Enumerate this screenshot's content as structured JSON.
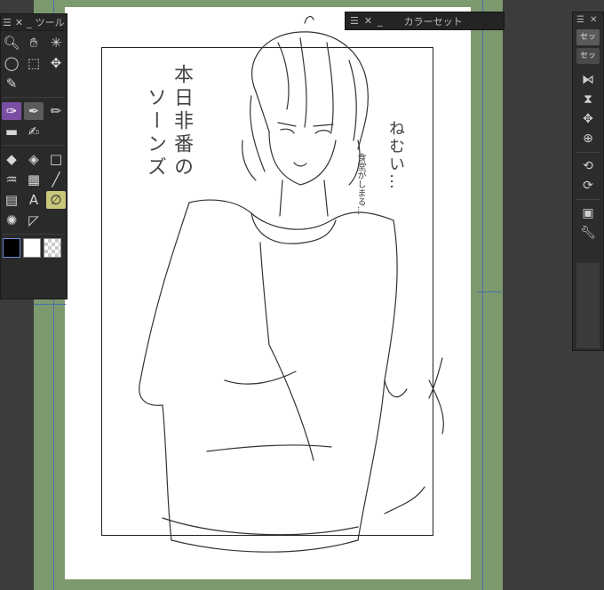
{
  "tool_panel": {
    "title": "ツール",
    "tools": [
      {
        "icon": "zoom-icon",
        "glyph": "🔍︎"
      },
      {
        "icon": "hand-icon",
        "glyph": "✋︎"
      },
      {
        "icon": "rotate-icon",
        "glyph": "✳"
      },
      {
        "icon": "lasso-select-icon",
        "glyph": "◯"
      },
      {
        "icon": "object-icon",
        "glyph": "⬚"
      },
      {
        "icon": "move-layer-icon",
        "glyph": "✥"
      },
      {
        "icon": "eyedropper-icon",
        "glyph": "✎"
      },
      {
        "icon": "blank-1",
        "glyph": ""
      },
      {
        "icon": "blank-2",
        "glyph": ""
      },
      {
        "icon": "pen-selected-icon",
        "glyph": "✑"
      },
      {
        "icon": "pen-nib-icon",
        "glyph": "✒"
      },
      {
        "icon": "pencil-icon",
        "glyph": "✏"
      },
      {
        "icon": "stamp-icon",
        "glyph": "▬"
      },
      {
        "icon": "airbrush-icon",
        "glyph": "✍"
      },
      {
        "icon": "blank-3",
        "glyph": ""
      },
      {
        "icon": "eraser-icon",
        "glyph": "◆"
      },
      {
        "icon": "fill-icon",
        "glyph": "◈"
      },
      {
        "icon": "figure-icon",
        "glyph": "□"
      },
      {
        "icon": "blend-icon",
        "glyph": "♒"
      },
      {
        "icon": "gradient-icon",
        "glyph": "▦"
      },
      {
        "icon": "brush-icon",
        "glyph": "╱"
      },
      {
        "icon": "frame-border-icon",
        "glyph": "▤"
      },
      {
        "icon": "text-icon",
        "glyph": "A"
      },
      {
        "icon": "correct-line-icon",
        "glyph": "∅"
      },
      {
        "icon": "ruler-icon",
        "glyph": "✺"
      },
      {
        "icon": "balloon-icon",
        "glyph": "◸"
      },
      {
        "icon": "blank-4",
        "glyph": ""
      }
    ]
  },
  "color_panel": {
    "title": "カラーセット"
  },
  "right_panel": {
    "tab1": "セッ",
    "tab2": "セッ",
    "icons": [
      {
        "icon": "flip-horizontal-icon",
        "glyph": "⧑"
      },
      {
        "icon": "flip-vertical-icon",
        "glyph": "⧗"
      },
      {
        "icon": "move-transform-icon",
        "glyph": "✥"
      },
      {
        "icon": "zoom-view-icon",
        "glyph": "⊕"
      },
      {
        "icon": "rotate-view-icon",
        "glyph": "⟲"
      },
      {
        "icon": "reset-view-icon",
        "glyph": "⟳"
      },
      {
        "icon": "screen-icon",
        "glyph": "▣"
      },
      {
        "icon": "settings-wrench-icon",
        "glyph": "🔧︎"
      }
    ]
  },
  "canvas_text": {
    "left_vertical_1": "本日非番の",
    "left_vertical_2": "ソーンズ",
    "right_vertical_1": "ねむい…",
    "right_vertical_2": "食堂がしまる…"
  },
  "colors": {
    "workspace": "#3c3c3c",
    "page_background": "#7d9a6f",
    "paper": "#ffffff",
    "guide": "#4a6ea8"
  }
}
